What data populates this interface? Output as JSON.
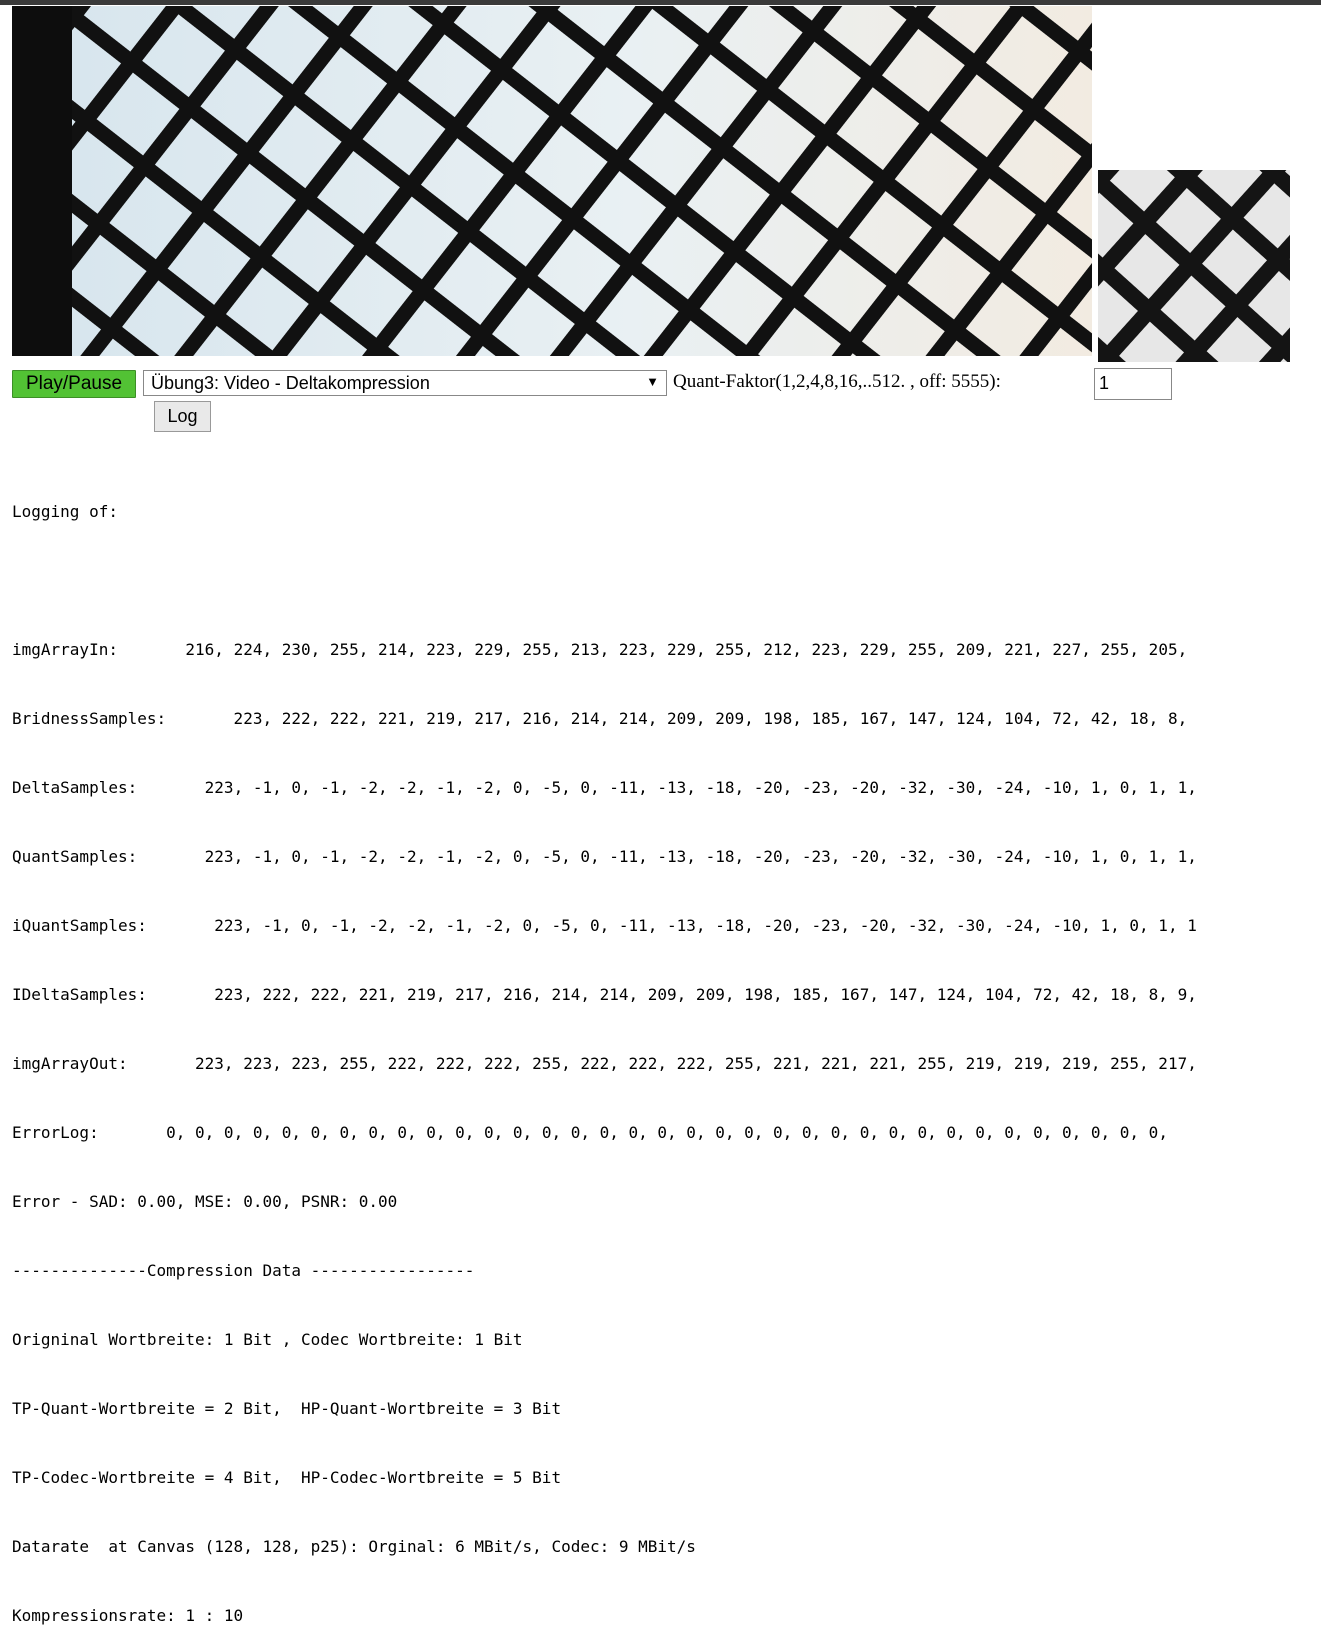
{
  "player": {
    "play_label": "Play/Pause",
    "exercise_selected": "Übung3: Video - Deltakompression",
    "quant_label": "Quant-Faktor(1,2,4,8,16,..512. , off: 5555):",
    "quant_value": "1",
    "log_label": "Log"
  },
  "icons": {
    "dropdown": "chevron-down-icon"
  },
  "log": {
    "header": "Logging of:",
    "rows": [
      {
        "label": "imgArrayIn:      ",
        "values": " 216, 224, 230, 255, 214, 223, 229, 255, 213, 223, 229, 255, 212, 223, 229, 255, 209, 221, 227, 255, 205,"
      },
      {
        "label": "BridnessSamples:      ",
        "values": " 223, 222, 222, 221, 219, 217, 216, 214, 214, 209, 209, 198, 185, 167, 147, 124, 104, 72, 42, 18, 8,"
      },
      {
        "label": "DeltaSamples:      ",
        "values": " 223, -1, 0, -1, -2, -2, -1, -2, 0, -5, 0, -11, -13, -18, -20, -23, -20, -32, -30, -24, -10, 1, 0, 1, 1,"
      },
      {
        "label": "QuantSamples:      ",
        "values": " 223, -1, 0, -1, -2, -2, -1, -2, 0, -5, 0, -11, -13, -18, -20, -23, -20, -32, -30, -24, -10, 1, 0, 1, 1,"
      },
      {
        "label": "iQuantSamples:      ",
        "values": " 223, -1, 0, -1, -2, -2, -1, -2, 0, -5, 0, -11, -13, -18, -20, -23, -20, -32, -30, -24, -10, 1, 0, 1, 1"
      },
      {
        "label": "IDeltaSamples:      ",
        "values": " 223, 222, 222, 221, 219, 217, 216, 214, 214, 209, 209, 198, 185, 167, 147, 124, 104, 72, 42, 18, 8, 9,"
      },
      {
        "label": "imgArrayOut:      ",
        "values": " 223, 223, 223, 255, 222, 222, 222, 255, 222, 222, 222, 255, 221, 221, 221, 255, 219, 219, 219, 255, 217,"
      },
      {
        "label": "ErrorLog:      ",
        "values": " 0, 0, 0, 0, 0, 0, 0, 0, 0, 0, 0, 0, 0, 0, 0, 0, 0, 0, 0, 0, 0, 0, 0, 0, 0, 0, 0, 0, 0, 0, 0, 0, 0, 0, 0,"
      }
    ],
    "error_line": "Error - SAD: 0.00, MSE: 0.00, PSNR: 0.00",
    "separator": "--------------Compression Data -----------------",
    "original_width": "Origninal Wortbreite: 1 Bit , Codec Wortbreite: 1 Bit",
    "tp_quant": "TP-Quant-Wortbreite = 2 Bit,  HP-Quant-Wortbreite = 3 Bit",
    "tp_codec": "TP-Codec-Wortbreite = 4 Bit,  HP-Codec-Wortbreite = 5 Bit",
    "datarate": "Datarate  at Canvas (128, 128, p25): Orginal: 6 MBit/s, Codec: 9 MBit/s",
    "compression_rate": "Kompressionsrate: 1 : 10"
  }
}
